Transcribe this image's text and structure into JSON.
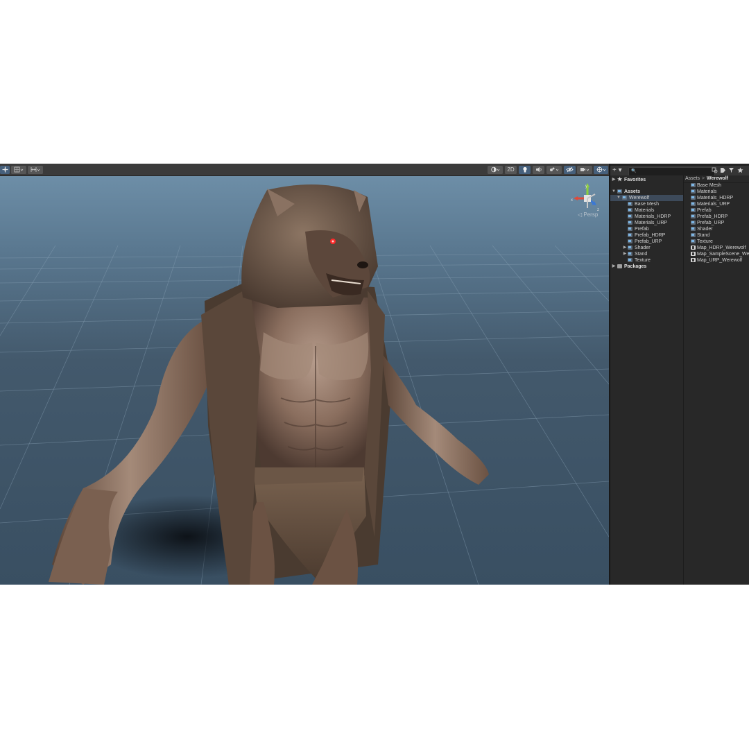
{
  "scene_toolbar": {
    "left_tools": [
      "tool-handle-icon",
      "grid-snap-icon",
      "increment-snap-icon"
    ],
    "shading_mode_icon": "shading-mode-icon",
    "mode_2d_label": "2D",
    "lighting_icon": "light-bulb-icon",
    "audio_icon": "audio-speaker-icon",
    "effects_icon": "effects-icon",
    "hidden_objects_icon": "hidden-eye-icon",
    "camera_icon": "scene-camera-icon",
    "gizmos_icon": "gizmos-icon"
  },
  "scene": {
    "projection_label": "◁ Persp",
    "gizmo_axes": {
      "y": "y",
      "x": "x",
      "z": "z"
    }
  },
  "project_panel": {
    "toolbar": {
      "add_label": "+ ▾",
      "search_placeholder": "🔍",
      "icons": [
        "search-by-type-icon",
        "search-by-label-icon",
        "filter-icon",
        "favorite-star-icon"
      ]
    },
    "tree": {
      "favorites": "Favorites",
      "assets": "Assets",
      "werewolf": "Werewolf",
      "children": [
        "Base Mesh",
        "Materials",
        "Materials_HDRP",
        "Materials_URP",
        "Prefab",
        "Prefab_HDRP",
        "Prefab_URP",
        "Shader",
        "Stand",
        "Texture"
      ],
      "packages": "Packages"
    },
    "breadcrumb": {
      "root": "Assets",
      "separator": ">",
      "current": "Werewolf"
    },
    "content_items": [
      {
        "label": "Base Mesh",
        "icon": "folder-icon"
      },
      {
        "label": "Materials",
        "icon": "folder-icon"
      },
      {
        "label": "Materials_HDRP",
        "icon": "folder-icon"
      },
      {
        "label": "Materials_URP",
        "icon": "folder-icon"
      },
      {
        "label": "Prefab",
        "icon": "folder-icon"
      },
      {
        "label": "Prefab_HDRP",
        "icon": "folder-icon"
      },
      {
        "label": "Prefab_URP",
        "icon": "folder-icon"
      },
      {
        "label": "Shader",
        "icon": "folder-icon"
      },
      {
        "label": "Stand",
        "icon": "folder-icon"
      },
      {
        "label": "Texture",
        "icon": "folder-icon"
      },
      {
        "label": "Map_HDRP_Werewolf",
        "icon": "unity-scene-icon"
      },
      {
        "label": "Map_SampleScene_Werewolf",
        "icon": "unity-scene-icon"
      },
      {
        "label": "Map_URP_Werewolf",
        "icon": "unity-scene-icon"
      }
    ]
  },
  "colors": {
    "toolbar_bg": "#3b3b3b",
    "panel_bg": "#282828",
    "selection": "#3d4a5a",
    "sky": "#6a8aa2",
    "ground": "#3c5366",
    "grid_line": "#8aa2b6",
    "axis_x": "#e04a3a",
    "axis_y": "#8ccf3a",
    "axis_z": "#3a78d6"
  }
}
